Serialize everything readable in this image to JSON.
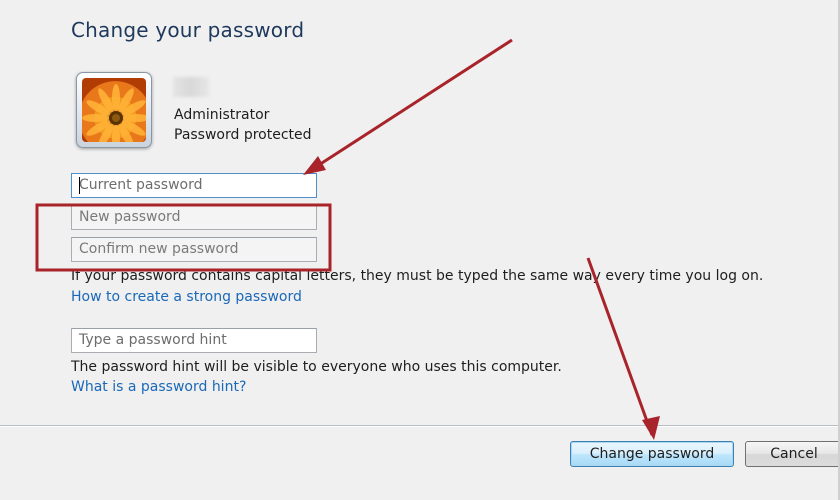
{
  "dialog": {
    "title": "Change your password",
    "user": {
      "role": "Administrator",
      "status": "Password protected"
    },
    "fields": {
      "current_password": "Current password",
      "new_password": "New password",
      "confirm_password": "Confirm new password",
      "password_hint": "Type a password hint"
    },
    "info_capital": "If your password contains capital letters, they must be typed the same way every time you log on.",
    "link_strong": "How to create a strong password",
    "hint_info": "The password hint will be visible to everyone who uses this computer.",
    "link_hint": "What is a password hint?",
    "buttons": {
      "change": "Change password",
      "cancel": "Cancel"
    }
  },
  "colors": {
    "title": "#1e395b",
    "link": "#1a68b8",
    "annotation": "#a8242a",
    "background": "#f0f0f0"
  },
  "icons": {
    "avatar": "orange-flower-user-picture"
  }
}
